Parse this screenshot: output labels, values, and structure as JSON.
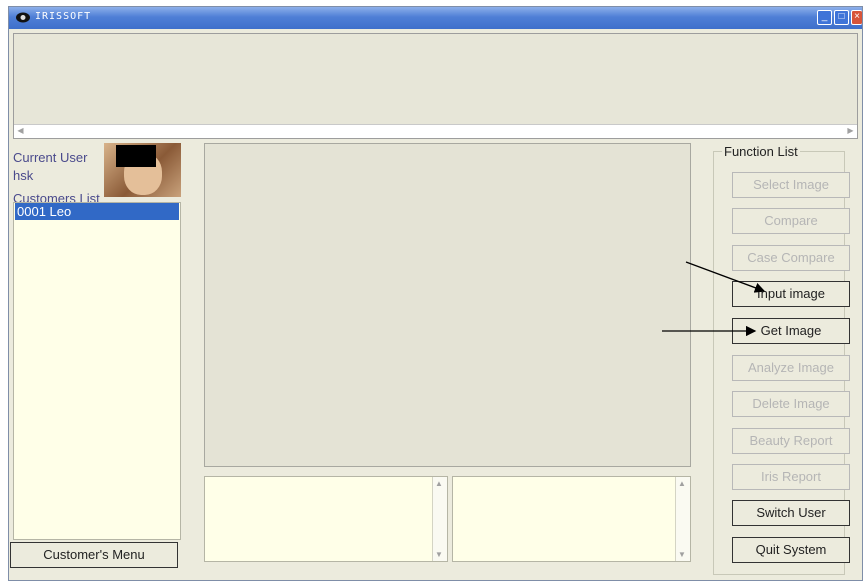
{
  "window": {
    "title": "IRISSOFT"
  },
  "sidebar": {
    "current_user_label": "Current User",
    "current_user_value": "hsk",
    "customers_list_label": "Customers List",
    "customers": [
      "0001 Leo"
    ],
    "menu_button": "Customer's Menu"
  },
  "function_list": {
    "title": "Function List",
    "buttons": [
      {
        "label": "Select Image",
        "enabled": false
      },
      {
        "label": "Compare",
        "enabled": false
      },
      {
        "label": "Case Compare",
        "enabled": false
      },
      {
        "label": "Input image",
        "enabled": true
      },
      {
        "label": "Get Image",
        "enabled": true
      },
      {
        "label": "Analyze Image",
        "enabled": false
      },
      {
        "label": "Delete Image",
        "enabled": false
      },
      {
        "label": "Beauty Report",
        "enabled": false
      },
      {
        "label": "Iris Report",
        "enabled": false
      },
      {
        "label": "Switch User",
        "enabled": true
      },
      {
        "label": "Quit System",
        "enabled": true
      }
    ]
  },
  "colors": {
    "titlebar": "#3e6fcb",
    "selection": "#3169c6",
    "panel": "#ecebdd",
    "list_bg": "#ffffe8"
  }
}
